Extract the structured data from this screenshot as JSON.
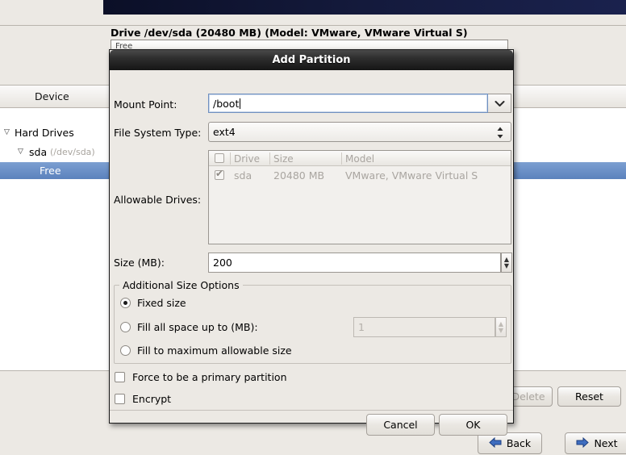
{
  "background": {
    "drive_title": "Drive /dev/sda (20480 MB) (Model: VMware, VMware Virtual S)",
    "drive_bar_label": "Free",
    "column_header": "Device",
    "tree": [
      {
        "label": "Hard Drives",
        "detail": "",
        "twisty": "▽",
        "selected": false
      },
      {
        "label": "sda",
        "detail": "(/dev/sda)",
        "twisty": "▽",
        "selected": false
      },
      {
        "label": "Free",
        "detail": "",
        "twisty": "",
        "selected": true
      }
    ],
    "buttons": {
      "delete": "Delete",
      "reset": "Reset",
      "back": "Back",
      "next": "Next",
      "back_arrow": "left-arrow-icon",
      "next_arrow": "right-arrow-icon"
    }
  },
  "dialog": {
    "title": "Add Partition",
    "mount_point": {
      "label": "Mount Point:",
      "value": "/boot",
      "dropdown_icon": "chevron-down-icon"
    },
    "file_system_type": {
      "label": "File System Type:",
      "value": "ext4",
      "dropdown_icon": "up-down-arrows-icon"
    },
    "allowable_drives": {
      "label": "Allowable Drives:",
      "columns": [
        "",
        "Drive",
        "Size",
        "Model"
      ],
      "rows": [
        {
          "checked": true,
          "drive": "sda",
          "size": "20480 MB",
          "model": "VMware, VMware Virtual S"
        }
      ]
    },
    "size": {
      "label": "Size (MB):",
      "value": "200"
    },
    "additional_size_options": {
      "title": "Additional Size Options",
      "options": [
        {
          "label": "Fixed size",
          "selected": true
        },
        {
          "label": "Fill all space up to (MB):",
          "selected": false
        },
        {
          "label": "Fill to maximum allowable size",
          "selected": false
        }
      ],
      "fill_up_to_value": "1"
    },
    "checkboxes": [
      {
        "label": "Force to be a primary partition",
        "checked": false
      },
      {
        "label": "Encrypt",
        "checked": false
      }
    ],
    "buttons": {
      "cancel": "Cancel",
      "ok": "OK"
    }
  },
  "colors": {
    "banner": "#1b2351",
    "selection": "#5b82bd",
    "dialog_bg": "#ece9e4",
    "titlebar": "#2e2e2e",
    "arrow_blue": "#3f6ec0"
  }
}
